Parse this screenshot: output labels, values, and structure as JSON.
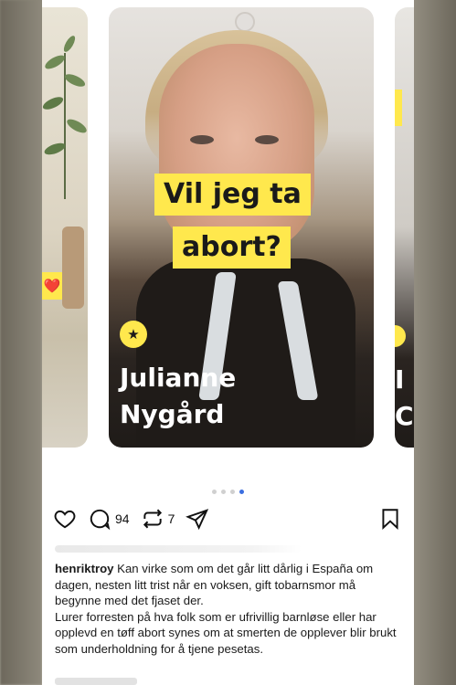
{
  "carousel": {
    "left_badge_icon": "heart-emoji",
    "main": {
      "caption_line1": "Vil jeg ta",
      "caption_line2": "abort?",
      "badge_icon": "star-icon",
      "name_line1": "Julianne",
      "name_line2": "Nygård"
    },
    "right_letters_line1": "I",
    "right_letters_line2": "C"
  },
  "pagination": {
    "total": 4,
    "active_index": 3
  },
  "actions": {
    "like_icon": "heart-outline-icon",
    "comment_icon": "comment-bubble-icon",
    "comment_count": "94",
    "repost_icon": "repost-icon",
    "repost_count": "7",
    "share_icon": "send-icon",
    "bookmark_icon": "bookmark-icon"
  },
  "comment": {
    "username": "henriktroy",
    "text1": " Kan virke som om det går litt dårlig i España om dagen, nesten litt trist når en voksen, gift tobarnsmor må begynne med det fjaset der.",
    "text2": "Lurer forresten på hva folk som er ufrivillig barnløse eller har opplevd en tøff abort synes om at smerten de opplever blir brukt som underholdning for å tjene pesetas."
  },
  "colors": {
    "caption_bg": "#ffe84d",
    "active_dot": "#3b6ee0"
  }
}
